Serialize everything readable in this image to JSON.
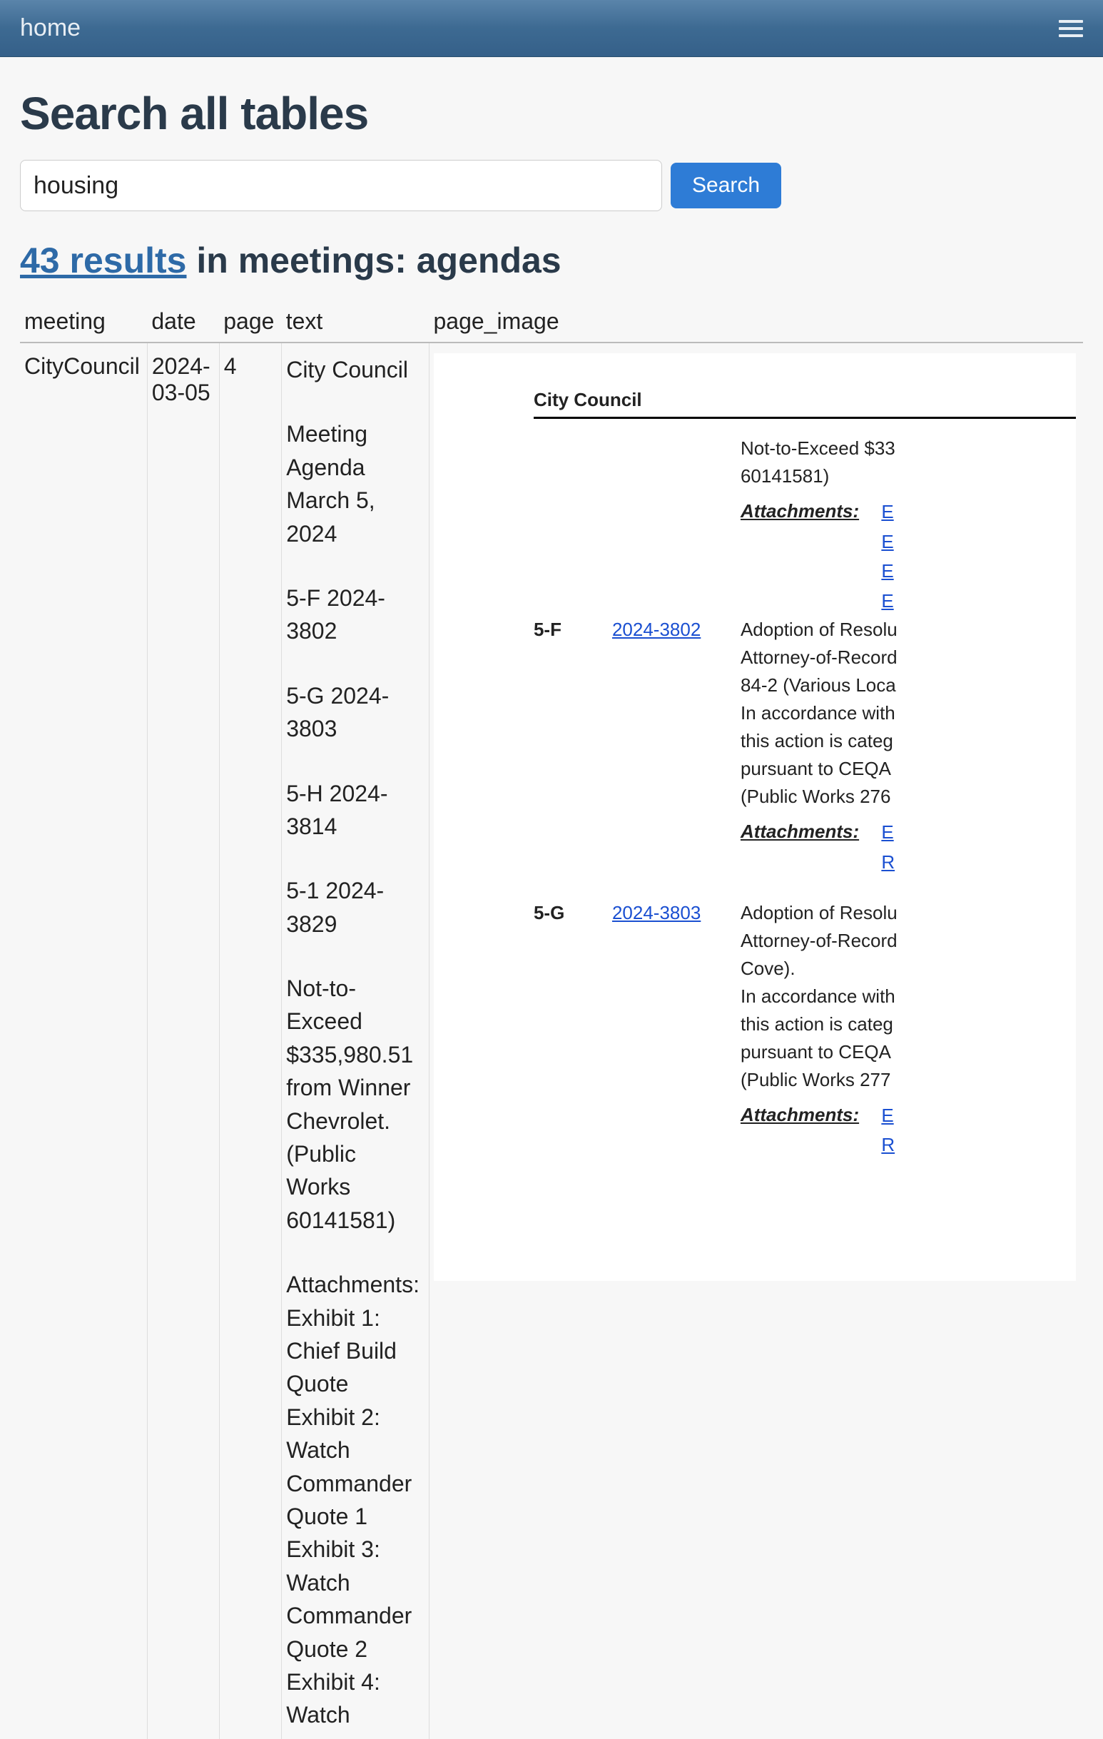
{
  "topbar": {
    "home_label": "home"
  },
  "page": {
    "title": "Search all tables"
  },
  "search": {
    "value": "housing",
    "button_label": "Search"
  },
  "results": {
    "count_link": "43 results",
    "heading_rest": " in meetings: agendas",
    "columns": {
      "meeting": "meeting",
      "date": "date",
      "page": "page",
      "text": "text",
      "page_image": "page_image"
    },
    "rows": [
      {
        "meeting": "CityCouncil",
        "date": "2024-03-05",
        "page": "4",
        "text_blocks": [
          "City Council",
          "Meeting Agenda March 5, 2024",
          "5-F 2024-3802",
          "5-G 2024-3803",
          "5-H 2024-3814",
          "5-1 2024-3829",
          "Not-to-Exceed $335,980.51 from Winner Chevrolet. (Public Works 60141581)",
          "Attachments: Exhibit 1: Chief Build Quote Exhibit 2: Watch Commander Quote 1 Exhibit 3: Watch Commander Quote 2 Exhibit 4: Watch"
        ]
      }
    ]
  },
  "doc": {
    "header": "City Council",
    "top_lines": {
      "line1": "Not-to-Exceed $33",
      "line2": "60141581)"
    },
    "attachments_label": "Attachments:",
    "top_attach_links": [
      "E",
      "E",
      "E",
      "E"
    ],
    "items": [
      {
        "itemno": "5-F",
        "fileno": "2024-3802",
        "body_lines": [
          "Adoption of Resolu",
          "Attorney-of-Record",
          "84-2 (Various Loca",
          "In accordance with",
          "this action is categ",
          "pursuant to CEQA",
          "(Public Works 276"
        ],
        "attach_links": [
          "E",
          "R"
        ]
      },
      {
        "itemno": "5-G",
        "fileno": "2024-3803",
        "body_lines": [
          "Adoption of Resolu",
          "Attorney-of-Record",
          "Cove).",
          "In accordance with",
          "this action is categ",
          "pursuant to CEQA",
          "(Public Works 277"
        ],
        "attach_links": [
          "E",
          "R"
        ]
      }
    ]
  }
}
